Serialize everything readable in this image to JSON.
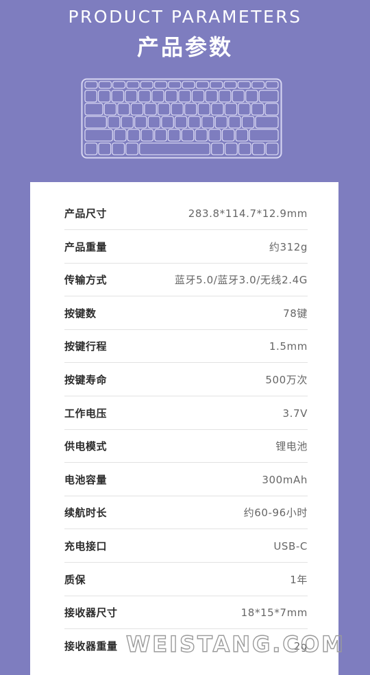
{
  "header": {
    "title_en": "PRODUCT PARAMETERS",
    "title_cn": "产品参数"
  },
  "keyboard_image": {
    "icon": "keyboard-icon",
    "stroke_color": "#d8d7f2"
  },
  "params": [
    {
      "label": "产品尺寸",
      "value": "283.8*114.7*12.9mm"
    },
    {
      "label": "产品重量",
      "value": "约312g"
    },
    {
      "label": "传输方式",
      "value": "蓝牙5.0/蓝牙3.0/无线2.4G"
    },
    {
      "label": "按键数",
      "value": "78键"
    },
    {
      "label": "按键行程",
      "value": "1.5mm"
    },
    {
      "label": "按键寿命",
      "value": "500万次"
    },
    {
      "label": "工作电压",
      "value": "3.7V"
    },
    {
      "label": "供电模式",
      "value": "锂电池"
    },
    {
      "label": "电池容量",
      "value": "300mAh"
    },
    {
      "label": "续航时长",
      "value": "约60-96小时"
    },
    {
      "label": "充电接口",
      "value": "USB-C"
    },
    {
      "label": "质保",
      "value": "1年"
    },
    {
      "label": "接收器尺寸",
      "value": "18*15*7mm"
    },
    {
      "label": "接收器重量",
      "value": "2g"
    }
  ],
  "watermark": {
    "text": "WEISTANG.COM"
  },
  "colors": {
    "background": "#7e7dbf",
    "card": "#ffffff",
    "label": "#2b2b2b",
    "value": "#666666",
    "divider": "#e2e2e2"
  }
}
